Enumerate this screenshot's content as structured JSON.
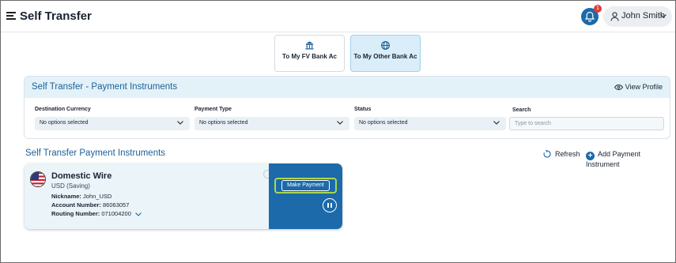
{
  "header": {
    "title": "Self Transfer",
    "notification_count": "1",
    "user_name": "John Smith"
  },
  "transfer_types": [
    {
      "label": "To My FV Bank Ac",
      "icon": "bank-icon",
      "active": false
    },
    {
      "label": "To My Other Bank Ac",
      "icon": "globe-icon",
      "active": true
    }
  ],
  "filters": {
    "title": "Self Transfer - Payment Instruments",
    "view_profile": "View Profile",
    "destination_currency": {
      "label": "Destination Currency",
      "value": "No options selected"
    },
    "payment_type": {
      "label": "Payment Type",
      "value": "No options selected"
    },
    "status": {
      "label": "Status",
      "value": "No options selected"
    },
    "search": {
      "label": "Search",
      "placeholder": "Type to search"
    }
  },
  "section": {
    "title": "Self Transfer Payment Instruments",
    "refresh": "Refresh",
    "add": "Add Payment Instrument"
  },
  "instrument": {
    "title": "Domestic Wire",
    "subtitle": "USD (Saving)",
    "nickname_label": "Nickname:",
    "nickname": "John_USD",
    "account_label": "Account Number:",
    "account": "86063057",
    "routing_label": "Routing Number:",
    "routing": "071004200",
    "make_payment": "Make Payment",
    "flag_icon": "us-flag-icon"
  },
  "colors": {
    "accent": "#1c6aa9",
    "highlight": "#a8d84a",
    "badge": "#e23a3a"
  }
}
